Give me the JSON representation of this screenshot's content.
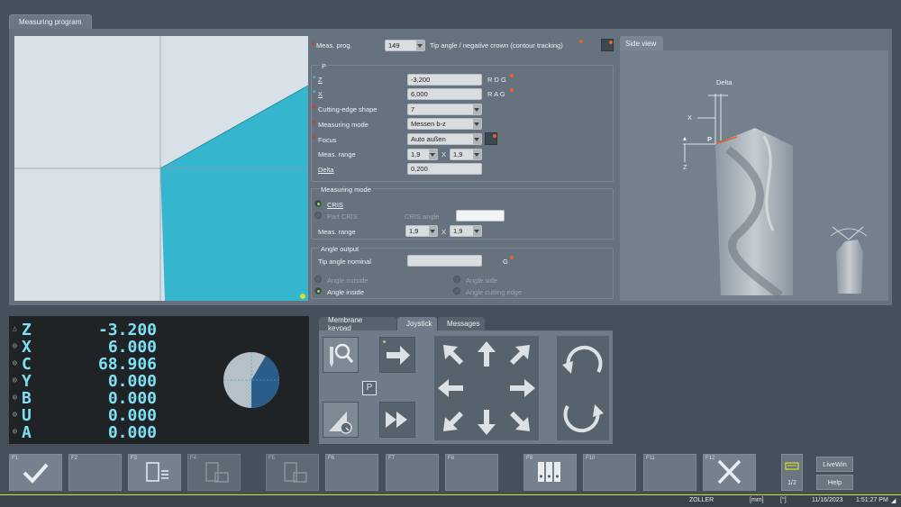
{
  "window": {
    "tab_title": "Measuring program"
  },
  "form": {
    "meas_prog_label": "Meas. prog.",
    "meas_prog_value": "149",
    "meas_prog_desc": "Tip angle / negative crown (contour tracking)",
    "p_group": "P",
    "z_label": "Z",
    "z_value": "-3,200",
    "z_unit": "R D G",
    "x_label": "X",
    "x_value": "6,000",
    "x_unit": "R A G",
    "shape_label": "Cutting-edge shape",
    "shape_value": "7",
    "mode_label": "Measuring mode",
    "mode_value": "Messen b-z",
    "focus_label": "Focus",
    "focus_value": "Auto außen",
    "range_label": "Meas. range",
    "range_a": "1,9",
    "range_sep": "X",
    "range_b": "1,9",
    "delta_label": "Delta",
    "delta_value": "0,200",
    "mm_group": "Measuring mode",
    "cris_label": "CRIS",
    "part_cris_label": "Part CRIS",
    "cris_angle_label": "CRIS angle",
    "cris_angle_value": "",
    "mm_range_label": "Meas. range",
    "mm_range_a": "1,9",
    "mm_range_sep": "X",
    "mm_range_b": "1,9",
    "angle_group": "Angle output",
    "tip_angle_label": "Tip angle nominal",
    "tip_angle_value": "",
    "tip_angle_unit": "G",
    "angle_outside": "Angle outside",
    "angle_side": "Angle side",
    "angle_inside": "Angle inside",
    "angle_cutting_edge": "Angle cutting edge"
  },
  "side_view": {
    "tab": "Side view",
    "delta": "Delta",
    "x": "X",
    "p": "P",
    "z": "Z"
  },
  "dro": {
    "axes": [
      {
        "axis": "Z",
        "value": "-3.200"
      },
      {
        "axis": "X",
        "value": "6.000"
      },
      {
        "axis": "C",
        "value": "68.906"
      },
      {
        "axis": "Y",
        "value": "0.000"
      },
      {
        "axis": "B",
        "value": "0.000"
      },
      {
        "axis": "U",
        "value": "0.000"
      },
      {
        "axis": "A",
        "value": "0.000"
      }
    ]
  },
  "bottom_tabs": {
    "membrane": "Membrane keypad",
    "joystick": "Joystick",
    "messages": "Messages"
  },
  "joystick": {
    "p_key": "P"
  },
  "fkeys": [
    {
      "key": "F1"
    },
    {
      "key": "F2"
    },
    {
      "key": "F3"
    },
    {
      "key": "F4"
    },
    {
      "key": "F5"
    },
    {
      "key": "F6"
    },
    {
      "key": "F7"
    },
    {
      "key": "F8"
    },
    {
      "key": "F9"
    },
    {
      "key": "F10"
    },
    {
      "key": "F11"
    },
    {
      "key": "F12"
    }
  ],
  "page_indicator": "1/2",
  "side_buttons": {
    "livewin": "LiveWin",
    "help": "Help"
  },
  "status": {
    "brand": "ZOLLER",
    "unit": "[mm]",
    "angle_unit": "[°]",
    "date": "11/16/2023",
    "time": "1:51:27 PM"
  },
  "colors": {
    "accent": "#2fb4cf",
    "dro_text": "#7ee0f2",
    "active_dot": "#8fe06a",
    "marker": "#e8622b"
  }
}
